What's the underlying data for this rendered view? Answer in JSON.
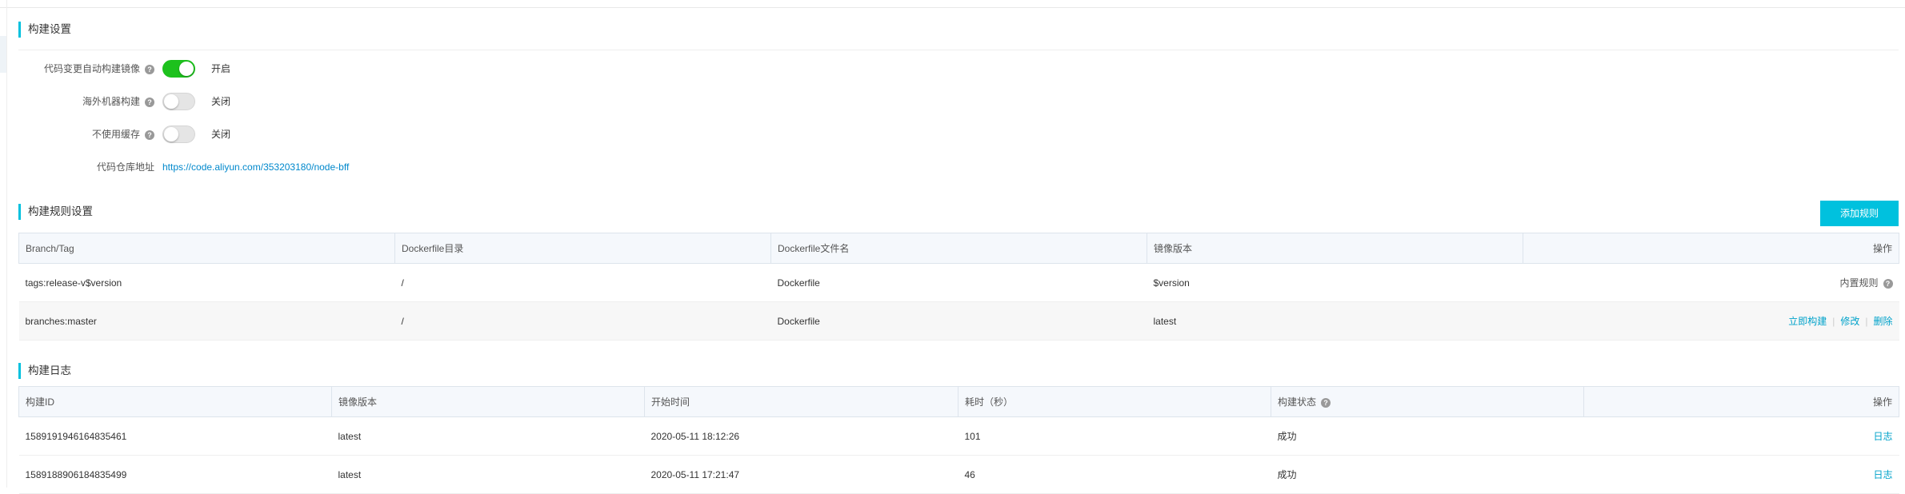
{
  "build_settings": {
    "title": "构建设置",
    "auto_build": {
      "label": "代码变更自动构建镜像",
      "state": "开启",
      "enabled": true
    },
    "overseas_build": {
      "label": "海外机器构建",
      "state": "关闭",
      "enabled": false
    },
    "no_cache": {
      "label": "不使用缓存",
      "state": "关闭",
      "enabled": false
    },
    "repo": {
      "label": "代码仓库地址",
      "url": "https://code.aliyun.com/353203180/node-bff"
    }
  },
  "help_icon_glyph": "?",
  "rules": {
    "title": "构建规则设置",
    "add_button": "添加规则",
    "columns": [
      "Branch/Tag",
      "Dockerfile目录",
      "Dockerfile文件名",
      "镜像版本",
      "操作"
    ],
    "rows": [
      {
        "branch_tag": "tags:release-v$version",
        "dir": "/",
        "filename": "Dockerfile",
        "version": "$version",
        "op_text": "内置规则"
      },
      {
        "branch_tag": "branches:master",
        "dir": "/",
        "filename": "Dockerfile",
        "version": "latest",
        "ops": [
          "立即构建",
          "修改",
          "删除"
        ]
      }
    ]
  },
  "logs": {
    "title": "构建日志",
    "columns": [
      "构建ID",
      "镜像版本",
      "开始时间",
      "耗时（秒）",
      "构建状态",
      "操作"
    ],
    "rows": [
      {
        "id": "1589191946164835461",
        "version": "latest",
        "start": "2020-05-11 18:12:26",
        "duration": "101",
        "status": "成功",
        "op": "日志"
      },
      {
        "id": "1589188906184835499",
        "version": "latest",
        "start": "2020-05-11 17:21:47",
        "duration": "46",
        "status": "成功",
        "op": "日志"
      }
    ]
  },
  "colors": {
    "accent": "#00c1de",
    "switch_on": "#1dc11d",
    "link": "#0088cc",
    "success": "#1e9e1e"
  }
}
